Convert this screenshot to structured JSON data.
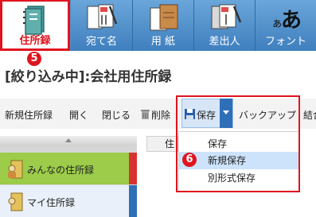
{
  "ribbon": {
    "tabs": [
      {
        "label": "住所録",
        "active": true
      },
      {
        "label": "宛て名",
        "active": false
      },
      {
        "label": "用 紙",
        "active": false
      },
      {
        "label": "差出人",
        "active": false
      },
      {
        "label": "フォント",
        "active": false
      }
    ]
  },
  "callouts": {
    "first": "5",
    "second": "6"
  },
  "title": "[絞り込み中]:会社用住所録",
  "toolbar": {
    "new_book": "新規住所録",
    "open": "開く",
    "close": "閉じる",
    "delete": "削除",
    "save": "保存",
    "backup": "バックアップ",
    "merge": "結合"
  },
  "save_menu": {
    "items": [
      "保存",
      "新規保存",
      "別形式保存"
    ],
    "highlighted": "新規保存"
  },
  "address_books": [
    "みんなの住所録",
    "マイ住所録"
  ],
  "column_header": "住",
  "colors": {
    "ribbon_blue": "#4e8ec7",
    "callout_red": "#e0141e",
    "active_green": "#9ccc4a",
    "menu_highlight": "#cce3fb"
  }
}
